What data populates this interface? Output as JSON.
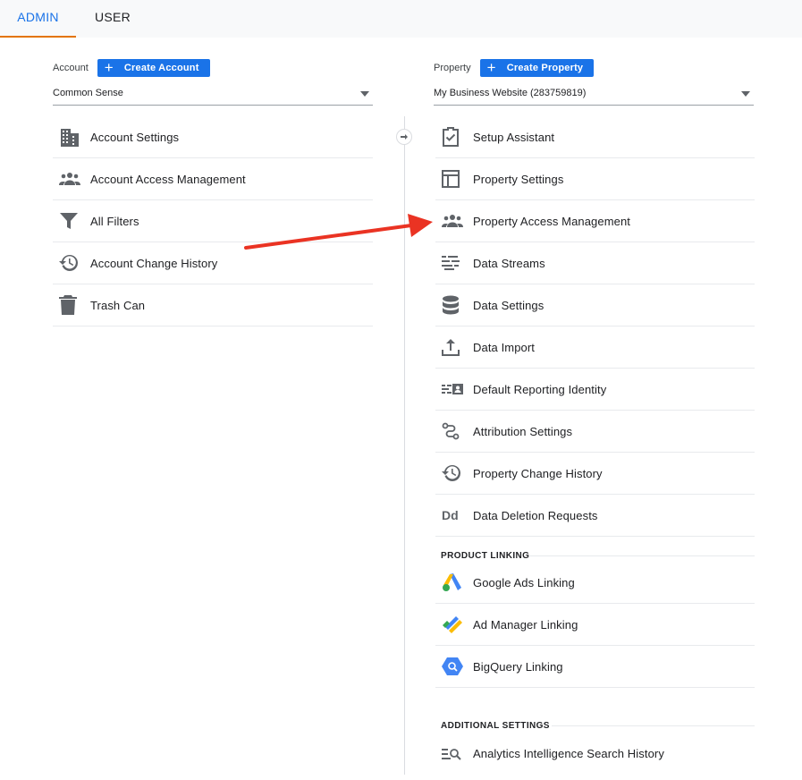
{
  "tabs": [
    {
      "label": "ADMIN",
      "active": true
    },
    {
      "label": "USER",
      "active": false
    }
  ],
  "account": {
    "label": "Account",
    "create_label": "Create Account",
    "selected": "Common Sense",
    "items": [
      {
        "label": "Account Settings",
        "icon": "building-icon"
      },
      {
        "label": "Account Access Management",
        "icon": "people-icon"
      },
      {
        "label": "All Filters",
        "icon": "filter-icon"
      },
      {
        "label": "Account Change History",
        "icon": "history-icon"
      },
      {
        "label": "Trash Can",
        "icon": "trash-icon"
      }
    ]
  },
  "property": {
    "label": "Property",
    "create_label": "Create Property",
    "selected": "My Business Website (283759819)",
    "items": [
      {
        "label": "Setup Assistant",
        "icon": "clipboard-check-icon"
      },
      {
        "label": "Property Settings",
        "icon": "layout-icon"
      },
      {
        "label": "Property Access Management",
        "icon": "people-icon"
      },
      {
        "label": "Data Streams",
        "icon": "streams-icon"
      },
      {
        "label": "Data Settings",
        "icon": "database-icon"
      },
      {
        "label": "Data Import",
        "icon": "upload-icon"
      },
      {
        "label": "Default Reporting Identity",
        "icon": "identity-icon"
      },
      {
        "label": "Attribution Settings",
        "icon": "attribution-icon"
      },
      {
        "label": "Property Change History",
        "icon": "history-icon"
      },
      {
        "label": "Data Deletion Requests",
        "icon": "dd-icon"
      }
    ],
    "product_linking": {
      "title": "PRODUCT LINKING",
      "items": [
        {
          "label": "Google Ads Linking",
          "icon": "google-ads-icon"
        },
        {
          "label": "Ad Manager Linking",
          "icon": "ad-manager-icon"
        },
        {
          "label": "BigQuery Linking",
          "icon": "bigquery-icon"
        }
      ]
    },
    "additional_settings": {
      "title": "ADDITIONAL SETTINGS",
      "items": [
        {
          "label": "Analytics Intelligence Search History",
          "icon": "search-history-icon"
        }
      ]
    }
  },
  "colors": {
    "accent": "#1a73e8",
    "tab_underline": "#e37400",
    "icon": "#5f6368",
    "annotation_arrow": "#ea3323"
  }
}
